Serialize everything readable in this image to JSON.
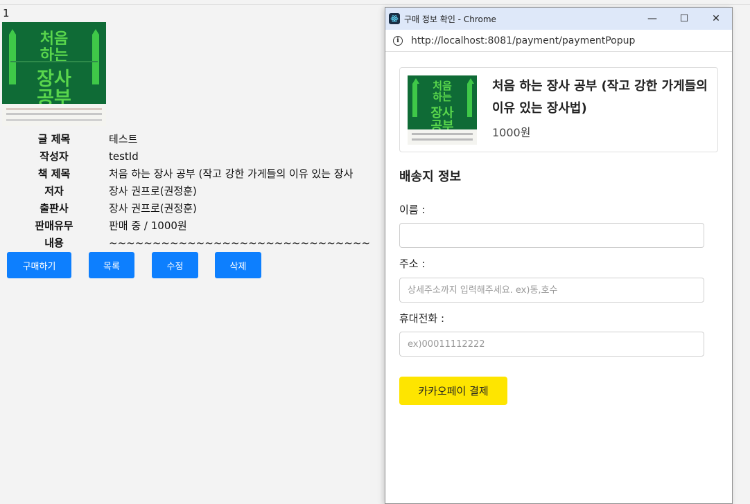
{
  "page": {
    "index": "1",
    "book_cover": {
      "line1": "처음",
      "line2": "하는",
      "line3": "장사",
      "line4": "공부"
    },
    "details": [
      {
        "label": "글 제목",
        "value": "테스트"
      },
      {
        "label": "작성자",
        "value": "testId"
      },
      {
        "label": "책 제목",
        "value": "처음 하는 장사 공부 (작고 강한 가게들의 이유 있는 장사"
      },
      {
        "label": "저자",
        "value": "장사 권프로(권정훈)"
      },
      {
        "label": "출판사",
        "value": "장사 권프로(권정훈)"
      },
      {
        "label": "판매유무",
        "value": "판매 중 / 1000원"
      },
      {
        "label": "내용",
        "value": "~~~~~~~~~~~~~~~~~~~~~~~~~~~~~~"
      }
    ],
    "buttons": {
      "buy": "구매하기",
      "list": "목록",
      "edit": "수정",
      "delete": "삭제"
    },
    "button_color": "#0d7ffe"
  },
  "popup": {
    "window_title": "구매 정보 확인 - Chrome",
    "controls": {
      "minimize": "—",
      "maximize": "☐",
      "close": "✕"
    },
    "url": "http://localhost:8081/payment/paymentPopup",
    "product": {
      "title": "처음 하는 장사 공부 (작고 강한 가게들의 이유 있는 장사법)",
      "price": "1000원"
    },
    "section_title": "배송지 정보",
    "name": {
      "label": "이름 :",
      "value": "",
      "placeholder": ""
    },
    "address": {
      "label": "주소 :",
      "value": "",
      "placeholder": "상세주소까지 입력해주세요. ex)동,호수"
    },
    "phone": {
      "label": "휴대전화 :",
      "value": "",
      "placeholder": "ex)00011112222"
    },
    "pay_button": "카카오페이 결제",
    "pay_color": "#fee500"
  }
}
